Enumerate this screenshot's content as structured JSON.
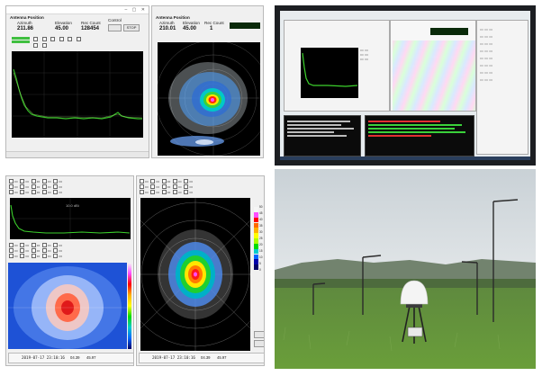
{
  "panel_a": {
    "left": {
      "title": "Antenna Position",
      "azimuth_label": "Azimuth",
      "elevation_label": "Elevation",
      "rec_count_label": "Rec Count",
      "control_label": "Control",
      "azimuth": "211.86",
      "elevation": "45.00",
      "rec_count": "128454",
      "stop_label": "STOP"
    },
    "right": {
      "title": "Antenna Position",
      "azimuth_label": "Azimuth",
      "elevation_label": "Elevation",
      "rec_count_label": "Rec Count",
      "azimuth": "210.01",
      "elevation": "45.00",
      "rec_count": "1"
    }
  },
  "panel_c": {
    "plot_label": "10.0 dBi",
    "timestamp_left": "2019-07-17 23:10:16",
    "az_left": "04.39",
    "el_left": "45.97",
    "timestamp_right": "2019-07-17 23:10:16",
    "az_right": "04.39",
    "el_right": "45.97",
    "colorbar_ticks": [
      "50",
      "45",
      "40",
      "35",
      "30",
      "25",
      "20",
      "15",
      "10",
      "5",
      "0"
    ],
    "colorbar_colors": [
      "#f5f5f5",
      "#ff4dff",
      "#ff0000",
      "#ff6a00",
      "#ffb000",
      "#ffff00",
      "#aaff00",
      "#00dd00",
      "#00cccc",
      "#0066ff",
      "#0000aa",
      "#000066"
    ]
  },
  "colors": {
    "plot_bg": "#000000",
    "trace": "#3cd12c",
    "app_bg": "#f0f0f0",
    "terminal_bg": "#0b0b0b"
  }
}
